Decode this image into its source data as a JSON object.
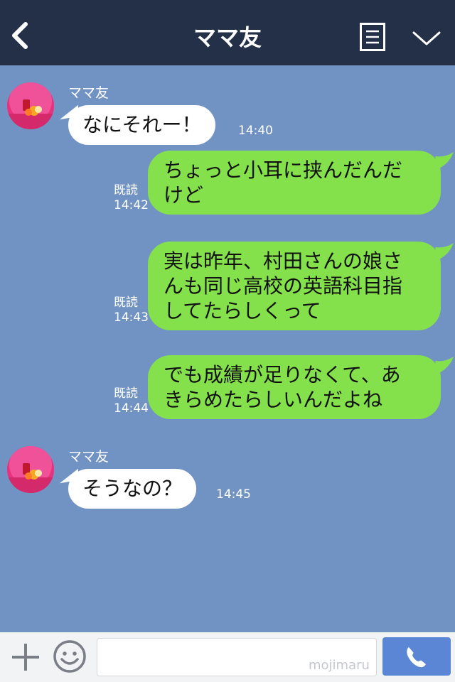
{
  "header": {
    "title": "ママ友",
    "back_icon": "chevron-left-icon",
    "menu_icon": "menu-list-icon",
    "dropdown_icon": "chevron-down-icon"
  },
  "messages": [
    {
      "side": "in",
      "sender": "ママ友",
      "text": "なにそれー！",
      "time": "14:40"
    },
    {
      "side": "out",
      "read": "既読",
      "time": "14:42",
      "lines": [
        "ちょっと小耳に挟んだんだ",
        "けど"
      ]
    },
    {
      "side": "out",
      "read": "既読",
      "time": "14:43",
      "lines": [
        "実は昨年、村田さんの娘さ",
        "んも同じ高校の英語科目指",
        "してたらしくって"
      ]
    },
    {
      "side": "out",
      "read": "既読",
      "time": "14:44",
      "lines": [
        "でも成績が足りなくて、あ",
        "きらめたらしいんだよね"
      ]
    },
    {
      "side": "in",
      "sender": "ママ友",
      "text": "そうなの？",
      "time": "14:45"
    }
  ],
  "input": {
    "value": "",
    "placeholder": "",
    "watermark": "mojimaru",
    "plus_icon": "plus-icon",
    "emoji_icon": "smiley-icon",
    "call_icon": "phone-icon"
  },
  "colors": {
    "header_bg": "#243048",
    "chat_bg": "#7193c3",
    "outgoing_bubble": "#84e14b",
    "incoming_bubble": "#ffffff",
    "call_button": "#5b86d6"
  }
}
